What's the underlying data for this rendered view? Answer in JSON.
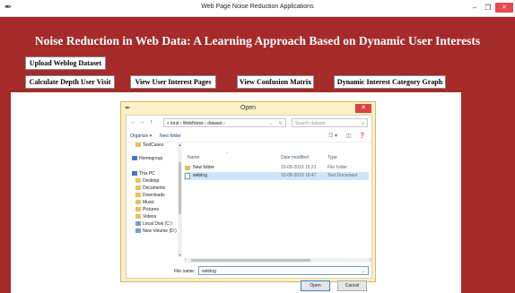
{
  "window": {
    "title": "Web Page Noise Reduction Applications",
    "minimize": "–",
    "maximize": "❐",
    "close": "✕"
  },
  "main": {
    "heading": "Noise Reduction in Web Data: A Learning Approach Based on Dynamic User Interests",
    "buttons": {
      "upload": "Upload Weblog Dataset",
      "depth": "Calculate Depth User Visit",
      "interest_pages": "View User Interest Pages",
      "confusion": "View Confusion Matrix",
      "graph": "Dynamic Interest Category Graph"
    }
  },
  "dialog": {
    "title": "Open",
    "close": "✕",
    "nav": {
      "back": "←",
      "forward": "→",
      "up": "↑"
    },
    "address": {
      "path": "«  knst  ›  WebNoise  ›  dataset  ›",
      "dropdown": "⌄",
      "refresh": "↻"
    },
    "search": {
      "placeholder": "Search dataset",
      "icon": "⌕"
    },
    "toolbar": {
      "organize": "Organize ▾",
      "new_folder": "New folder",
      "view_icon": "☷ ▾",
      "pane_icon": "◫",
      "help_icon": "❓"
    },
    "tree": [
      {
        "label": "TestCases",
        "icon": "folder-icon"
      },
      {
        "label": "Homegroup",
        "icon": "homegroup-icon"
      },
      {
        "label": "This PC",
        "icon": "computer-icon"
      },
      {
        "label": "Desktop",
        "icon": "folder-icon"
      },
      {
        "label": "Documents",
        "icon": "folder-icon"
      },
      {
        "label": "Downloads",
        "icon": "folder-icon"
      },
      {
        "label": "Music",
        "icon": "folder-icon"
      },
      {
        "label": "Pictures",
        "icon": "folder-icon"
      },
      {
        "label": "Videos",
        "icon": "folder-icon"
      },
      {
        "label": "Local Disk (C:)",
        "icon": "drive-icon"
      },
      {
        "label": "New Volume (D:)",
        "icon": "drive-icon"
      }
    ],
    "columns": {
      "name": "Name",
      "date": "Date modified",
      "type": "Type"
    },
    "files": [
      {
        "name": "New folder",
        "date": "15-08-2019 15:21",
        "type": "File folder",
        "icon": "folder-icon",
        "selected": false
      },
      {
        "name": "weblog",
        "date": "15-08-2019 16:47",
        "type": "Text Document",
        "icon": "document-icon",
        "selected": true
      }
    ],
    "filename": {
      "label": "File name:",
      "value": "weblog",
      "dropdown": "⌄"
    },
    "buttons": {
      "open": "Open",
      "cancel": "Cancel"
    }
  }
}
